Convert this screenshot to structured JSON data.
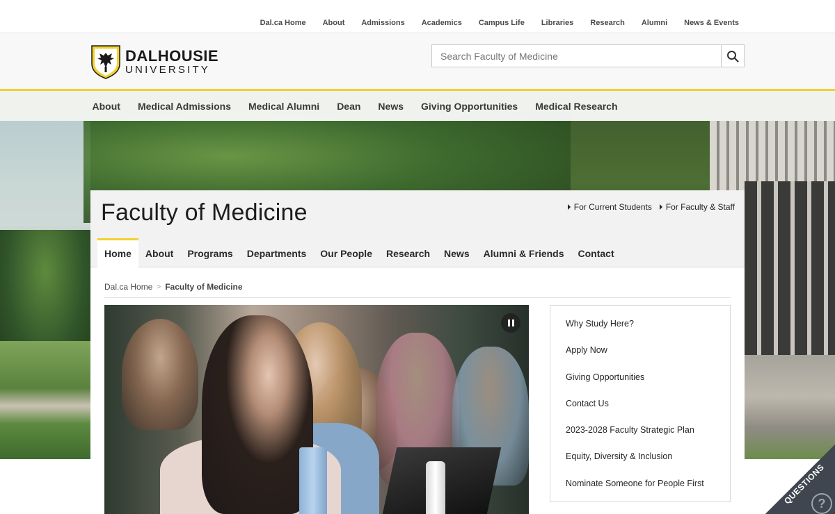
{
  "utility_nav": {
    "items": [
      "Dal.ca Home",
      "About",
      "Admissions",
      "Academics",
      "Campus Life",
      "Libraries",
      "Research",
      "Alumni",
      "News & Events"
    ]
  },
  "header": {
    "logo_line1": "DALHOUSIE",
    "logo_line2": "UNIVERSITY",
    "search_placeholder": "Search Faculty of Medicine"
  },
  "main_nav": {
    "items": [
      "About",
      "Medical Admissions",
      "Medical Alumni",
      "Dean",
      "News",
      "Giving Opportunities",
      "Medical Research"
    ]
  },
  "faculty": {
    "title": "Faculty of Medicine",
    "quick_links": [
      "For Current Students",
      "For Faculty & Staff"
    ]
  },
  "section_nav": {
    "active": "Home",
    "items": [
      "Home",
      "About",
      "Programs",
      "Departments",
      "Our People",
      "Research",
      "News",
      "Alumni & Friends",
      "Contact"
    ]
  },
  "breadcrumb": {
    "home": "Dal.ca Home",
    "current": "Faculty of Medicine"
  },
  "side_menu": {
    "items": [
      "Why Study Here?",
      "Apply Now",
      "Giving Opportunities",
      "Contact Us",
      "2023-2028 Faculty Strategic Plan",
      "Equity, Diversity & Inclusion",
      "Nominate Someone for People First"
    ]
  },
  "questions_widget": {
    "label": "QUESTIONS",
    "icon_glyph": "?"
  },
  "colors": {
    "accent_gold": "#f2d130",
    "text_dark": "#242424",
    "questions_bg": "#3f4650"
  }
}
